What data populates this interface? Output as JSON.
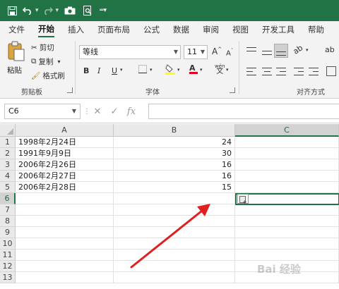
{
  "window": {
    "quick_access": {
      "save_icon": "save-icon",
      "undo_icon": "undo-icon",
      "redo_icon": "redo-icon",
      "camera_icon": "camera-icon",
      "print_preview_icon": "print-preview-icon",
      "customize_icon": "customize-qat-icon"
    },
    "accent": "#217346"
  },
  "ribbon_tabs": [
    "文件",
    "开始",
    "插入",
    "页面布局",
    "公式",
    "数据",
    "审阅",
    "视图",
    "开发工具",
    "帮助"
  ],
  "active_tab": "开始",
  "clipboard": {
    "paste": "粘贴",
    "cut": "剪切",
    "copy": "复制",
    "format_painter": "格式刷",
    "group_label": "剪贴板"
  },
  "font": {
    "name": "等线",
    "size": "11",
    "bold": "B",
    "italic": "I",
    "underline": "U",
    "grow": "A",
    "shrink": "A",
    "font_color": "A",
    "phonetic": "wén",
    "group_label": "字体"
  },
  "alignment": {
    "group_label": "对齐方式"
  },
  "formula_bar": {
    "name_box": "C6",
    "cancel": "✕",
    "enter": "✓",
    "fx": "fx",
    "formula": ""
  },
  "sheet": {
    "columns": [
      "A",
      "B",
      "C"
    ],
    "rows": [
      "1",
      "2",
      "3",
      "4",
      "5",
      "6",
      "7",
      "8",
      "9",
      "10",
      "11",
      "12",
      "13"
    ],
    "data": [
      {
        "a": "1998年2月24日",
        "b": "24"
      },
      {
        "a": "1991年9月9日",
        "b": "30"
      },
      {
        "a": "2006年2月26日",
        "b": "16"
      },
      {
        "a": "2006年2月27日",
        "b": "16"
      },
      {
        "a": "2006年2月28日",
        "b": "15"
      }
    ],
    "selected_cell": "C6"
  },
  "watermark": "Bai 经验"
}
